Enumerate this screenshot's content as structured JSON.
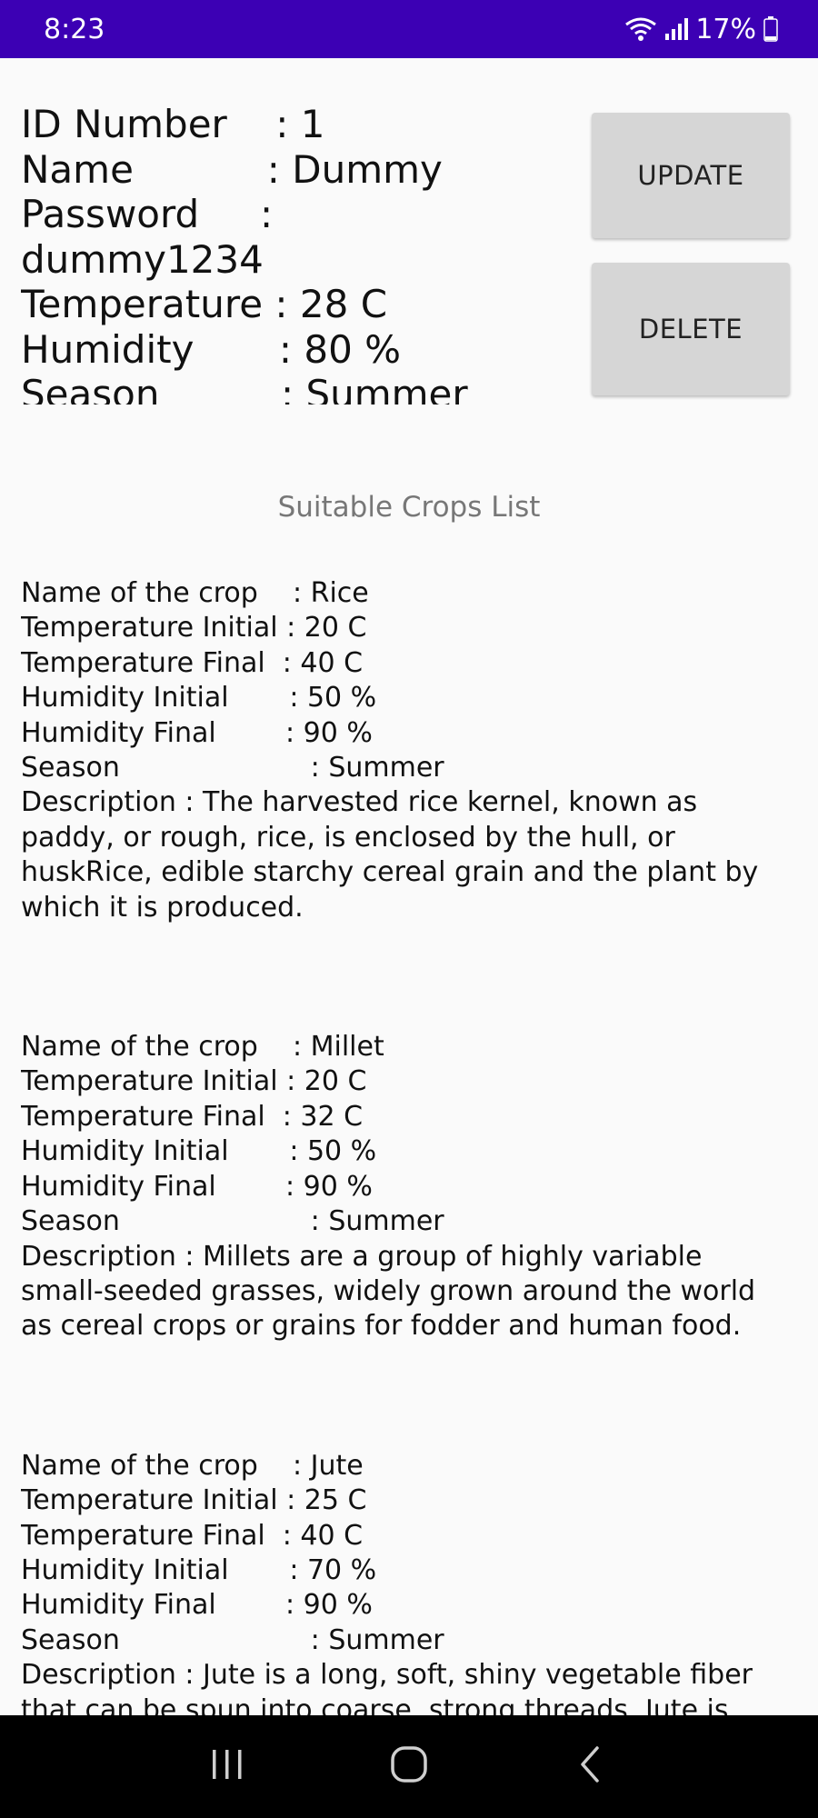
{
  "status": {
    "time": "8:23",
    "battery": "17%"
  },
  "profile": {
    "id_label": "ID Number    ",
    "id_value": ": 1",
    "name_label": "Name           ",
    "name_value": ": Dummy",
    "password_label": "Password     ",
    "password_value": ":",
    "password_wrap": "dummy1234",
    "temp_label": "Temperature ",
    "temp_value": ": 28 C",
    "humidity_label": "Humidity       ",
    "humidity_value": ": 80 %",
    "season_label": "Season          ",
    "season_value": ": Summer"
  },
  "buttons": {
    "update": "UPDATE",
    "delete": "DELETE"
  },
  "list_title": "Suitable Crops List",
  "crops": [
    {
      "name_line": "Name of the crop    : Rice",
      "temp_init_line": "Temperature Initial : 20 C",
      "temp_final_line": "Temperature Final  : 40 C",
      "hum_init_line": "Humidity Initial       : 50 %",
      "hum_final_line": "Humidity Final        : 90 %",
      "season_line": "Season                      : Summer",
      "desc_line": "Description               : The harvested rice kernel, known as paddy, or rough, rice, is enclosed by the hull, or huskRice, edible starchy cereal grain and the plant by which it is produced."
    },
    {
      "name_line": "Name of the crop    : Millet",
      "temp_init_line": "Temperature Initial : 20 C",
      "temp_final_line": "Temperature Final  : 32 C",
      "hum_init_line": "Humidity Initial       : 50 %",
      "hum_final_line": "Humidity Final        : 90 %",
      "season_line": "Season                      : Summer",
      "desc_line": "Description               : Millets are a group of highly variable small-seeded grasses, widely grown around the world as cereal crops or grains for fodder and human food."
    },
    {
      "name_line": "Name of the crop    : Jute",
      "temp_init_line": "Temperature Initial : 25 C",
      "temp_final_line": "Temperature Final  : 40 C",
      "hum_init_line": "Humidity Initial       : 70 %",
      "hum_final_line": "Humidity Final        : 90 %",
      "season_line": "Season                      : Summer",
      "desc_line": "Description               : Jute is a long, soft, shiny vegetable fiber that can be spun into coarse, strong threads. Jute is"
    }
  ],
  "nav": {
    "recents": "recents-icon",
    "home": "home-icon",
    "back": "back-icon"
  },
  "colors": {
    "status_bar": "#3c00b4",
    "button_bg": "#d6d6d6",
    "title_gray": "#777777"
  }
}
